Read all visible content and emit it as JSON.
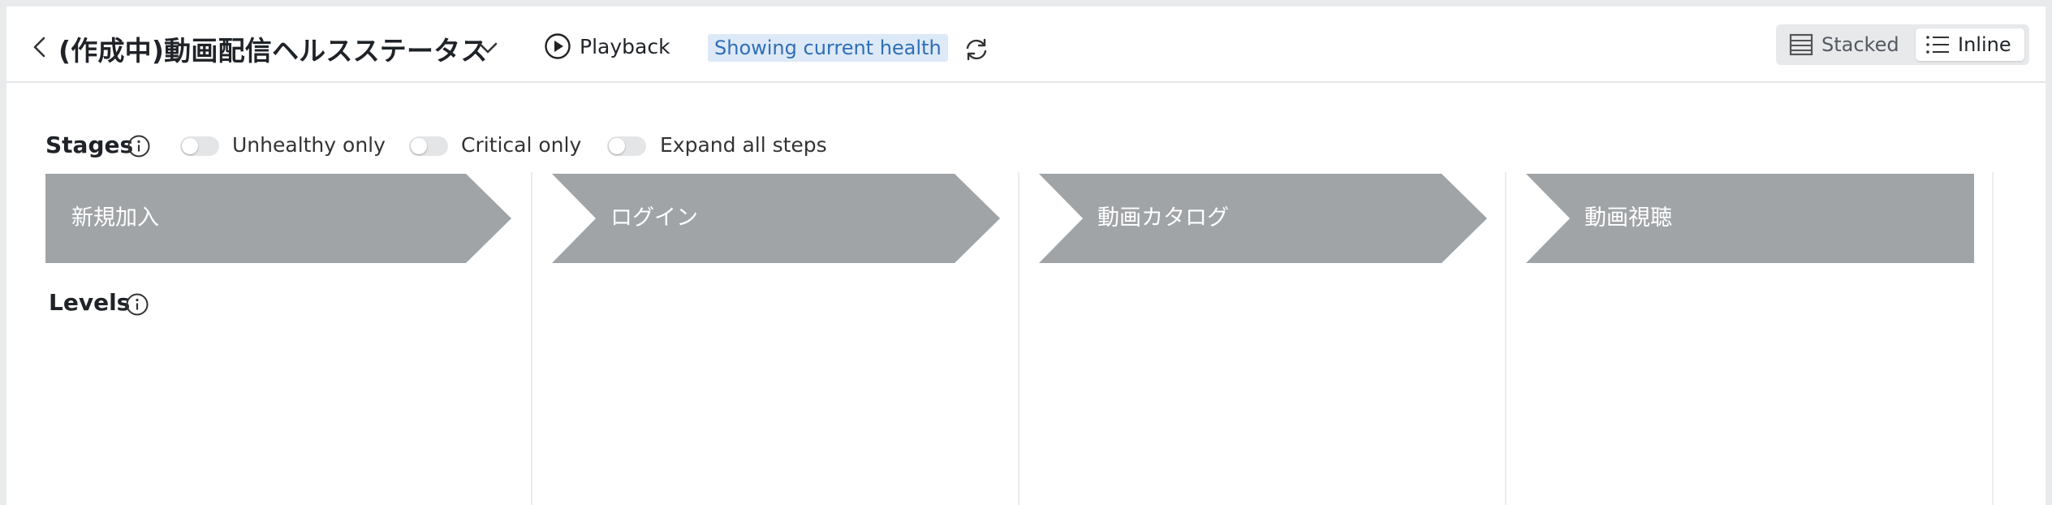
{
  "header": {
    "title": "(作成中)動画配信ヘルスステータス",
    "playback_label": "Playback",
    "health_badge": "Showing current health",
    "view_toggle": {
      "stacked_label": "Stacked",
      "inline_label": "Inline",
      "selected": "Inline"
    }
  },
  "controls": {
    "stages_label": "Stages",
    "toggles": [
      {
        "label": "Unhealthy only",
        "on": false
      },
      {
        "label": "Critical only",
        "on": false
      },
      {
        "label": "Expand all steps",
        "on": false
      }
    ]
  },
  "stages": [
    {
      "label": "新規加入"
    },
    {
      "label": "ログイン"
    },
    {
      "label": "動画カタログ"
    },
    {
      "label": "動画視聴"
    }
  ],
  "levels_label": "Levels",
  "colors": {
    "stage_fill": "#a0a4a7",
    "badge_bg": "#dde9f7",
    "badge_text": "#2f6fb5"
  },
  "icons": [
    "chevron-left-icon",
    "chevron-down-icon",
    "play-circle-icon",
    "info-icon",
    "refresh-icon",
    "stacked-list-icon",
    "inline-list-icon"
  ]
}
